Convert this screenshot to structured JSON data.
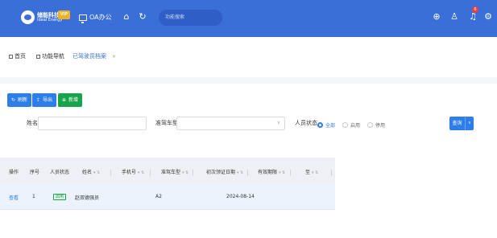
{
  "topbar": {
    "logo_name": "储能科技",
    "logo_sub": "Ideal Energy",
    "vip": "VIP",
    "office": "OA办公",
    "search_placeholder": "功能搜索",
    "notification_count": "6",
    "icons": [
      "home-icon",
      "refresh-icon",
      "plus-circle-icon",
      "shirt-icon",
      "bell-icon",
      "settings-icon"
    ]
  },
  "tabs": [
    {
      "label": "首页",
      "active": false
    },
    {
      "label": "功能导航",
      "active": false
    },
    {
      "label": "已驾驶员档案",
      "active": true,
      "close": "×"
    }
  ],
  "toolbar": {
    "refresh": "刷新",
    "export": "导出",
    "add": "新增"
  },
  "filters": {
    "name_label": "姓名",
    "vehicle_label": "准驾车型",
    "status_label": "人员状态",
    "status_options": [
      "全部",
      "启用",
      "停用"
    ],
    "status_selected": "全部",
    "query": "查询"
  },
  "table": {
    "columns": [
      "操作",
      "序号",
      "人员状态",
      "姓名",
      "手机号",
      "准驾车型",
      "初次领证日期",
      "有效期限",
      "至"
    ],
    "rows": [
      {
        "action": "查看",
        "index": "1",
        "status": "启用",
        "name": "赵双德强员",
        "phone": "",
        "vehicle": "A2",
        "first_license": "2024-08-14",
        "valid": "",
        "to": ""
      }
    ]
  },
  "colors": {
    "topbar": "#3a6fd8",
    "primary": "#2d7ee8",
    "success": "#19a34d",
    "badge": "#ee3e3e"
  }
}
